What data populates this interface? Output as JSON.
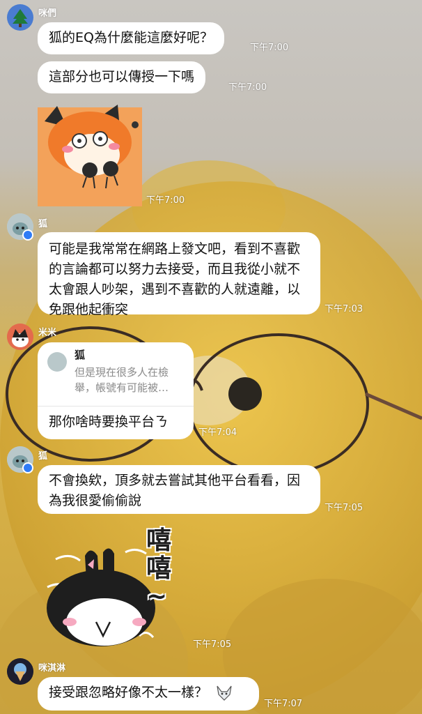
{
  "messages": [
    {
      "sender": "咪們",
      "text_1": "狐的EQ為什麼能這麼好呢？",
      "time_1": "下午7:00",
      "text_2": "這部分也可以傳授一下嗎",
      "time_2": "下午7:00",
      "sticker_time": "下午7:00"
    },
    {
      "sender": "狐",
      "text": "可能是我常常在網路上發文吧，看到不喜歡的言論都可以努力去接受，而且我從小就不太會跟人吵架，遇到不喜歡的人就遠離，以免跟他起衝突",
      "time": "下午7:03"
    },
    {
      "sender": "米米",
      "quote_name": "狐",
      "quote_text": "但是現在很多人在檢舉，帳號有可能被…",
      "text": "那你啥時要換平台ㄋ",
      "time": "下午7:04"
    },
    {
      "sender": "狐",
      "text": "不會換欸，頂多就去嘗試其他平台看看，因為我很愛偷偷說",
      "time": "下午7:05",
      "sticker_caption": "嘻嘻~",
      "sticker_time": "下午7:05"
    },
    {
      "sender": "咪淇淋",
      "text": "接受跟忽略好像不太一樣？",
      "time": "下午7:07"
    }
  ],
  "colors": {
    "bubble": "#ffffff",
    "badge": "#2f7cf6",
    "time_text": "#ffffff"
  },
  "icons": [
    "tree-avatar-icon",
    "fox-sticker",
    "cat-sticker",
    "verified-badge-icon",
    "wolf-emoji-icon"
  ]
}
